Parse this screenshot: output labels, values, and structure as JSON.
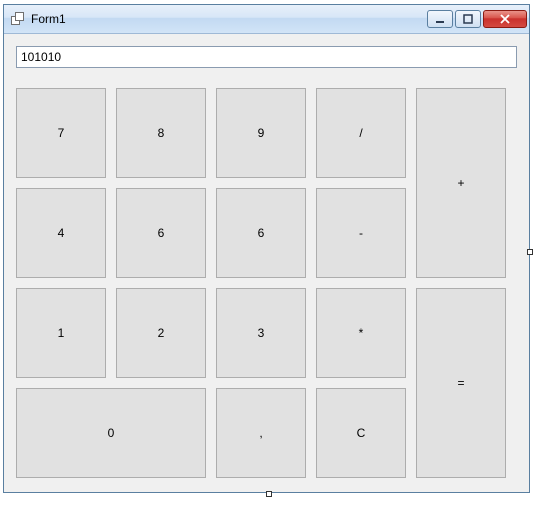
{
  "window": {
    "title": "Form1"
  },
  "display": {
    "value": "101010"
  },
  "buttons": {
    "r0c0": "7",
    "r0c1": "8",
    "r0c2": "9",
    "r0c3": "/",
    "plus": "+",
    "r1c0": "4",
    "r1c1": "6",
    "r1c2": "6",
    "r1c3": "-",
    "r2c0": "1",
    "r2c1": "2",
    "r2c2": "3",
    "r2c3": "*",
    "equals": "=",
    "zero": "0",
    "comma": ",",
    "clear": "C"
  }
}
